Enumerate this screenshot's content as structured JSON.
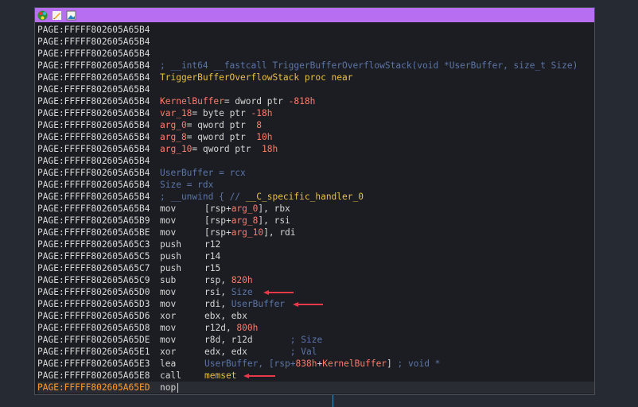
{
  "toolbar": {
    "icons": [
      "graph-icon",
      "edit-icon",
      "image-icon"
    ]
  },
  "addr": {
    "a0": "PAGE:FFFFF802605A65B4",
    "b9": "PAGE:FFFFF802605A65B9",
    "be": "PAGE:FFFFF802605A65BE",
    "c3": "PAGE:FFFFF802605A65C3",
    "c5": "PAGE:FFFFF802605A65C5",
    "c7": "PAGE:FFFFF802605A65C7",
    "c9": "PAGE:FFFFF802605A65C9",
    "d0": "PAGE:FFFFF802605A65D0",
    "d3": "PAGE:FFFFF802605A65D3",
    "d6": "PAGE:FFFFF802605A65D6",
    "d8": "PAGE:FFFFF802605A65D8",
    "de": "PAGE:FFFFF802605A65DE",
    "e1": "PAGE:FFFFF802605A65E1",
    "e3": "PAGE:FFFFF802605A65E3",
    "e8": "PAGE:FFFFF802605A65E8",
    "ed": "PAGE:FFFFF802605A65ED"
  },
  "header": {
    "sig_comment": "; __int64 __fastcall TriggerBufferOverflowStack(void *UserBuffer, size_t Size)",
    "proc": "TriggerBufferOverflowStack proc near"
  },
  "vars": [
    {
      "name": "KernelBuffer",
      "decl": "= dword ptr ",
      "val": "-818h"
    },
    {
      "name": "var_18",
      "decl": "= byte ptr ",
      "val": "-18h"
    },
    {
      "name": "arg_0",
      "decl": "= qword ptr  ",
      "val": "8"
    },
    {
      "name": "arg_8",
      "decl": "= qword ptr  ",
      "val": "10h"
    },
    {
      "name": "arg_10",
      "decl": "= qword ptr  ",
      "val": "18h"
    }
  ],
  "regs": [
    {
      "name": "UserBuffer",
      "rest": " = rcx"
    },
    {
      "name": "Size",
      "rest": " = rdx"
    }
  ],
  "unwind": {
    "semi": "; __unwind { ",
    "comment": "// ",
    "handler": "__C_specific_handler_0"
  },
  "asm": {
    "mov": "mov",
    "push": "push",
    "sub": "sub",
    "xor": "xor",
    "lea": "lea",
    "call": "call",
    "nop": "nop",
    "rsp": "[rsp+",
    "arg_0": "arg_0",
    "arg_8": "arg_8",
    "arg_10": "arg_10",
    "rbx": "], rbx",
    "rsi_tail": "], rsi",
    "rdi_tail": "], rdi",
    "r12": "r12",
    "r14": "r14",
    "r15": "r15",
    "rsp_plain": "rsp, ",
    "v820": "820h",
    "rsi_a": "rsi, ",
    "size": "Size",
    "rdi_a": "rdi, ",
    "userbuffer": "UserBuffer",
    "ebx": "ebx, ebx",
    "r12d": "r12d, ",
    "v800": "800h",
    "r8d": "r8d, r12d       ",
    "c_size": "; Size",
    "edx": "edx, edx        ",
    "c_val": "; Val",
    "lea_a": "UserBuffer, [rsp+",
    "v838": "838h",
    "plus": "+",
    "kb": "KernelBuffer",
    "lea_b": "] ",
    "c_void": "; void *",
    "memset": "memset"
  }
}
